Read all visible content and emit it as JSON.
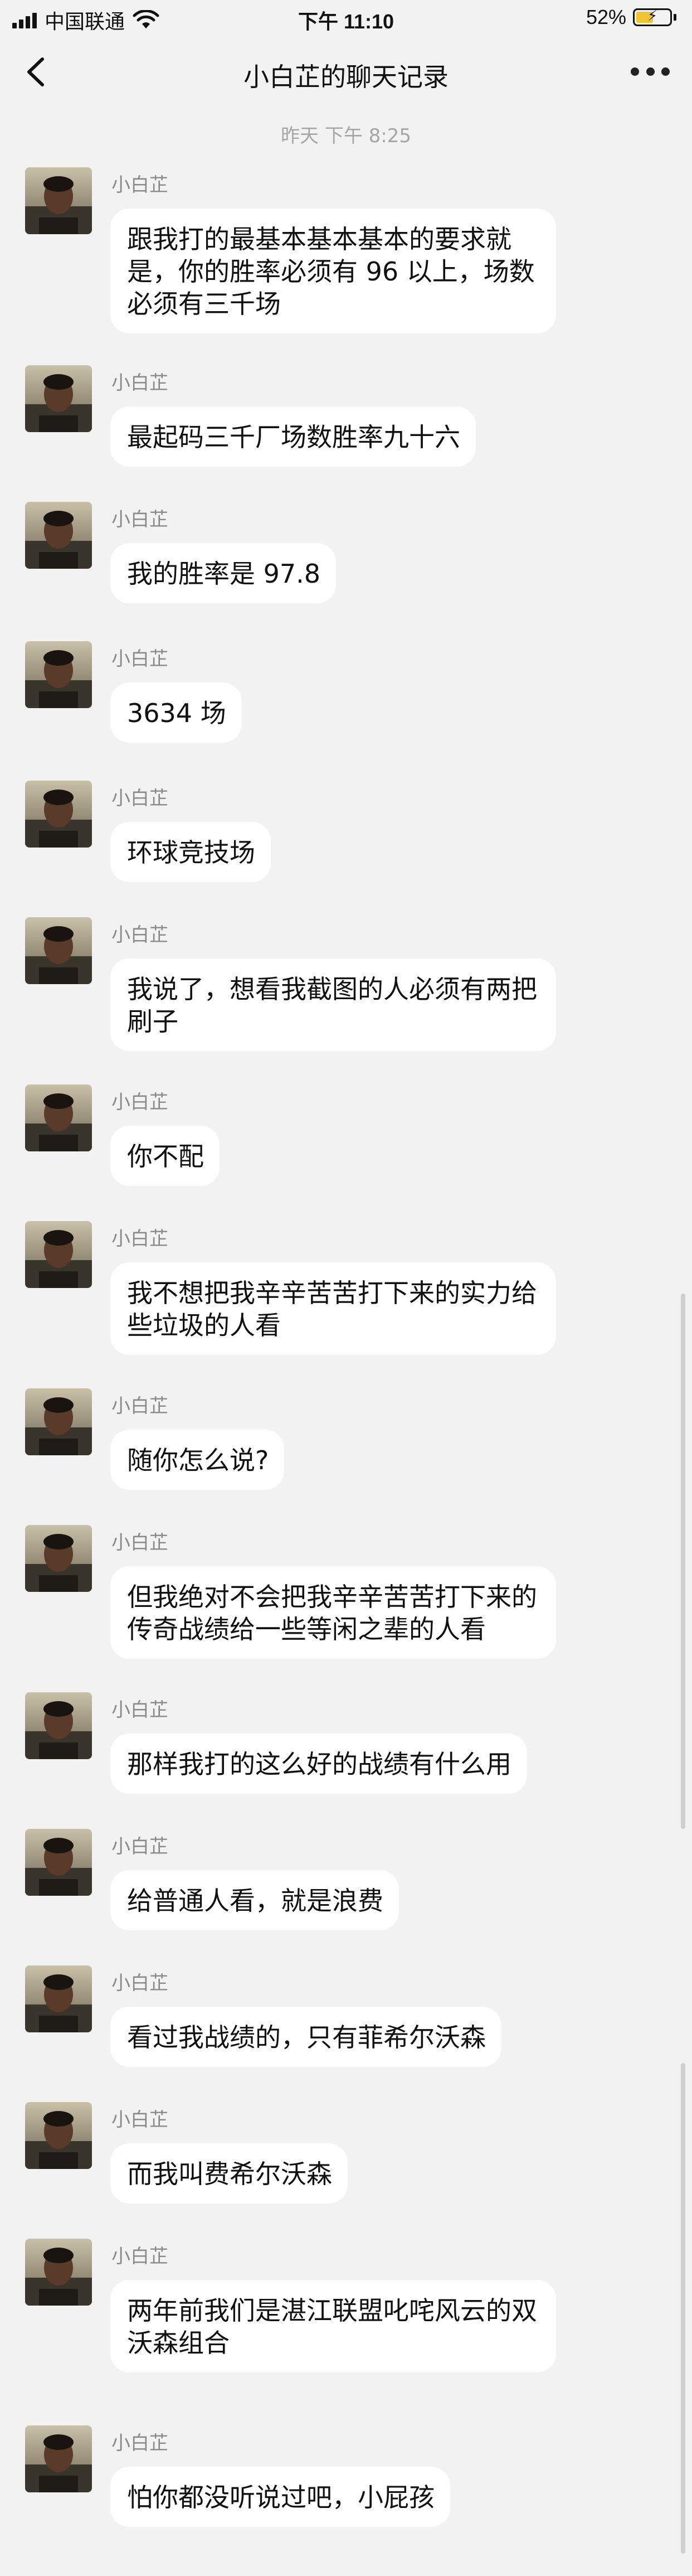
{
  "status_bar": {
    "carrier": "中国联通",
    "time": "下午 11:10",
    "battery_percent": "52%",
    "battery_level": 0.52,
    "battery_color": "#f1c232",
    "icons": [
      "signal-icon",
      "wifi-icon",
      "battery-icon",
      "charging-bolt-icon"
    ]
  },
  "nav": {
    "title": "小白芷的聊天记录",
    "back_icon": "chevron-left-icon",
    "more_icon": "more-dots-icon"
  },
  "timestamp": "昨天 下午 8:25",
  "messages": [
    {
      "sender": "小白芷",
      "text": "跟我打的最基本基本基本的要求就是，你的胜率必须有 96 以上，场数必须有三千场"
    },
    {
      "sender": "小白芷",
      "text": "最起码三千厂场数胜率九十六"
    },
    {
      "sender": "小白芷",
      "text": "我的胜率是 97.8"
    },
    {
      "sender": "小白芷",
      "text": "3634 场"
    },
    {
      "sender": "小白芷",
      "text": "环球竞技场"
    },
    {
      "sender": "小白芷",
      "text": "我说了，想看我截图的人必须有两把刷子"
    },
    {
      "sender": "小白芷",
      "text": "你不配"
    },
    {
      "sender": "小白芷",
      "text": "我不想把我辛辛苦苦打下来的实力给些垃圾的人看"
    },
    {
      "sender": "小白芷",
      "text": "随你怎么说?"
    },
    {
      "sender": "小白芷",
      "text": "但我绝对不会把我辛辛苦苦打下来的传奇战绩给一些等闲之辈的人看"
    },
    {
      "sender": "小白芷",
      "text": "那样我打的这么好的战绩有什么用"
    },
    {
      "sender": "小白芷",
      "text": "给普通人看，就是浪费"
    },
    {
      "sender": "小白芷",
      "text": "看过我战绩的，只有菲希尔沃森"
    },
    {
      "sender": "小白芷",
      "text": "而我叫费希尔沃森"
    },
    {
      "sender": "小白芷",
      "text": "两年前我们是湛江联盟叱咤风云的双沃森组合"
    },
    {
      "sender": "小白芷",
      "text": "怕你都没听说过吧，小屁孩"
    }
  ]
}
